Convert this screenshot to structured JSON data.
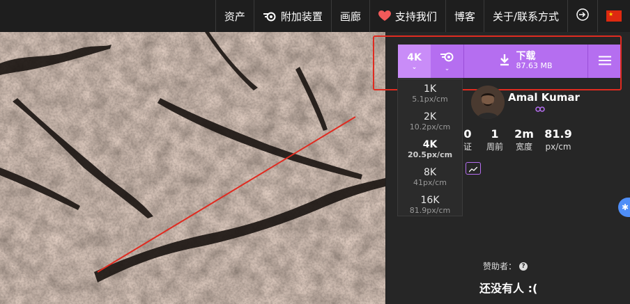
{
  "nav": {
    "assets": "资产",
    "addon": "附加装置",
    "gallery": "画廊",
    "support": "支持我们",
    "blog": "博客",
    "about": "关于/联系方式"
  },
  "download": {
    "resolution": "4K",
    "label": "下载",
    "size": "87.63 MB"
  },
  "resolutions": [
    {
      "res": "1K",
      "density": "5.1px/cm"
    },
    {
      "res": "2K",
      "density": "10.2px/cm"
    },
    {
      "res": "4K",
      "density": "20.5px/cm"
    },
    {
      "res": "8K",
      "density": "41px/cm"
    },
    {
      "res": "16K",
      "density": "81.9px/cm"
    }
  ],
  "selected_resolution": "4K",
  "author": {
    "name": "Amal Kumar"
  },
  "stats": [
    {
      "value": "0",
      "label": "证"
    },
    {
      "value": "1",
      "label": "周前"
    },
    {
      "value": "2m",
      "label": "宽度"
    },
    {
      "value": "81.9",
      "label": "px/cm"
    }
  ],
  "sponsors": {
    "label": "赞助者：",
    "empty_text": "还没有人 :("
  },
  "colors": {
    "accent": "#b56ef0",
    "accent_light": "#c98cf8",
    "annotation": "#e02b20"
  }
}
